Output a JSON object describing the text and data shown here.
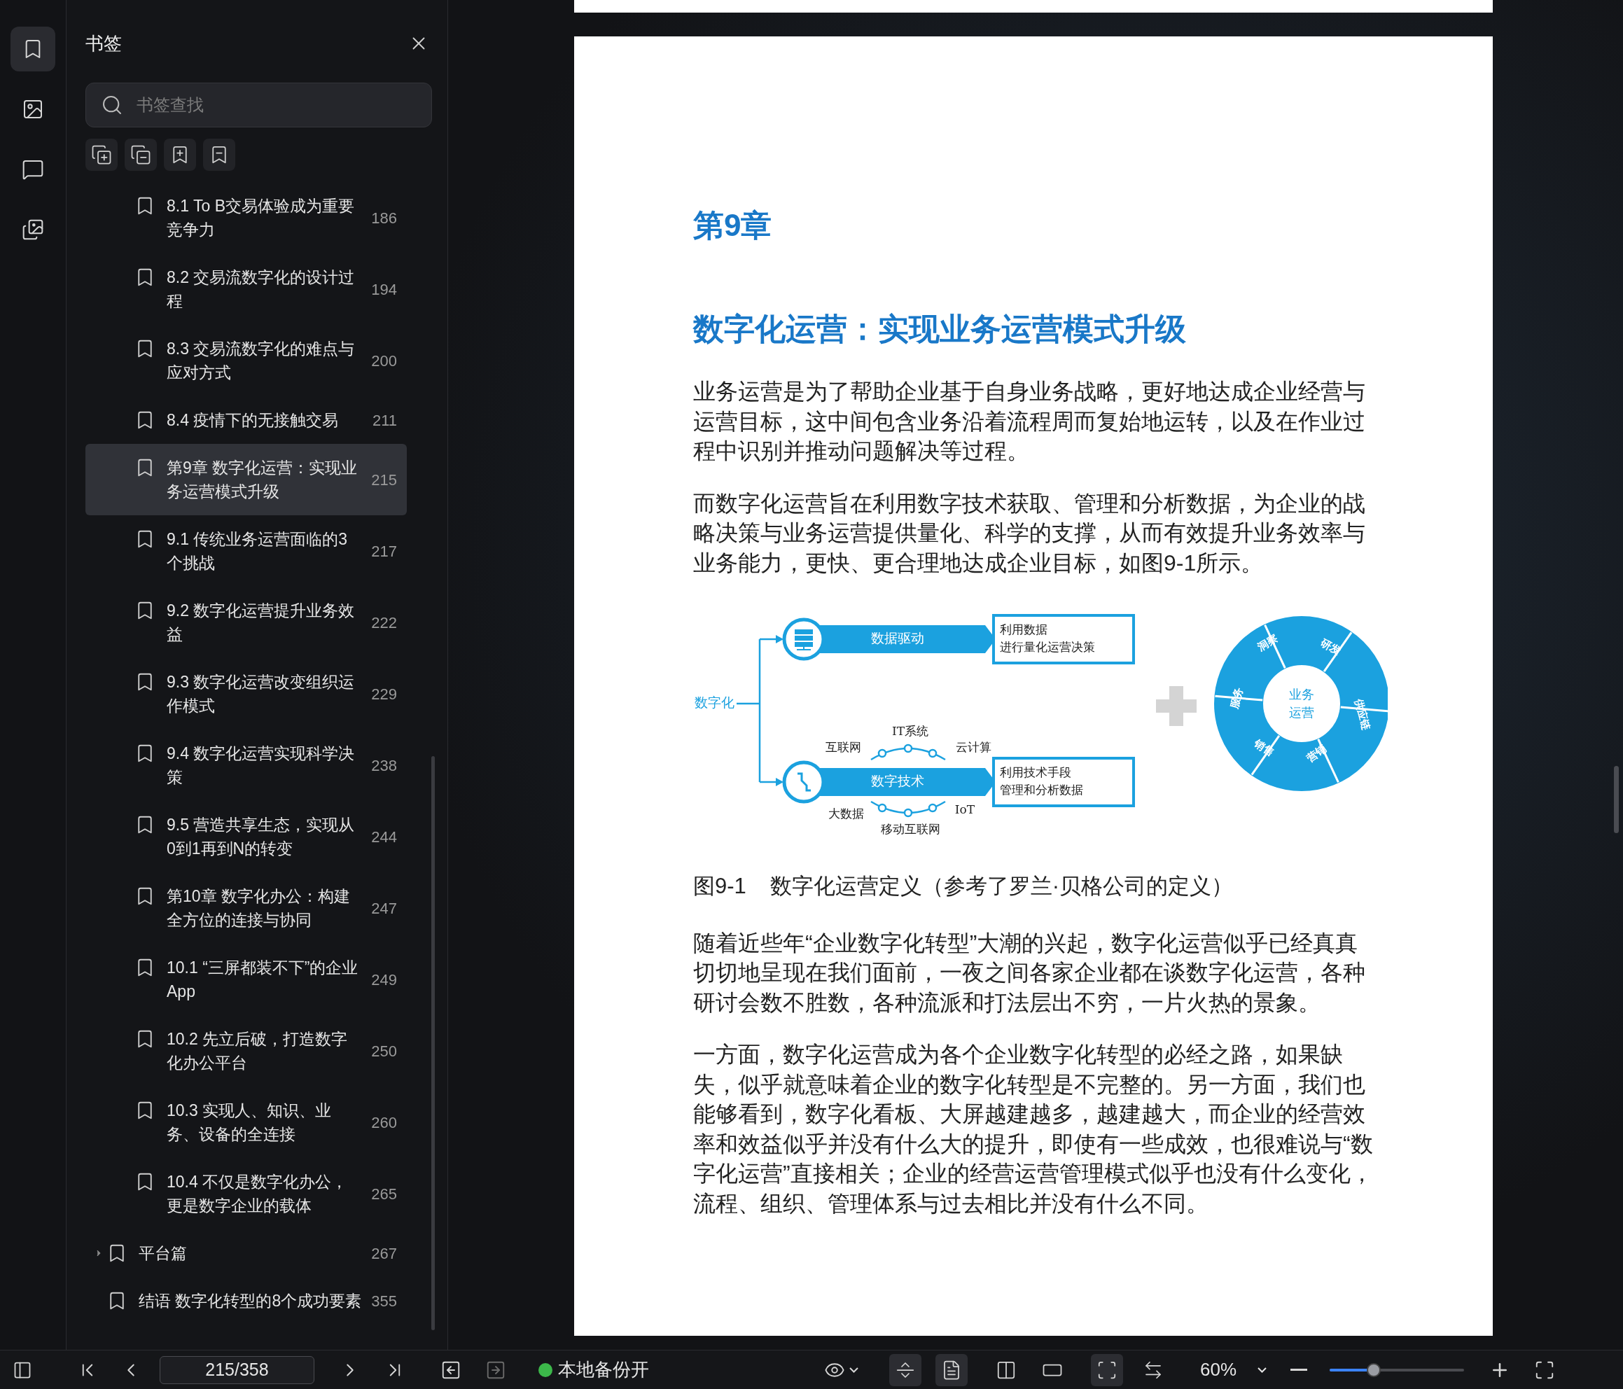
{
  "rail": [
    {
      "kind": "bookmark",
      "selected": true
    },
    {
      "kind": "image",
      "selected": false
    },
    {
      "kind": "comment",
      "selected": false
    },
    {
      "kind": "pages",
      "selected": false
    }
  ],
  "sidebar": {
    "title": "书签",
    "search": {
      "placeholder": "书签查找"
    },
    "items": [
      {
        "children": [
          {
            "title": "8.1 To B交易体验成为重要竞争力",
            "page": "186",
            "selected": false
          },
          {
            "title": "8.2 交易流数字化的设计过程",
            "page": "194",
            "selected": false
          },
          {
            "title": "8.3 交易流数字化的难点与应对方式",
            "page": "200",
            "selected": false
          },
          {
            "title": "8.4 疫情下的无接触交易",
            "page": "211",
            "selected": false
          },
          {
            "title": "第9章 数字化运营：实现业务运营模式升级",
            "page": "215",
            "selected": true
          },
          {
            "title": "9.1 传统业务运营面临的3个挑战",
            "page": "217",
            "selected": false
          },
          {
            "title": "9.2 数字化运营提升业务效益",
            "page": "222",
            "selected": false
          },
          {
            "title": "9.3 数字化运营改变组织运作模式",
            "page": "229",
            "selected": false
          },
          {
            "title": "9.4 数字化运营实现科学决策",
            "page": "238",
            "selected": false
          },
          {
            "title": "9.5 营造共享生态，实现从0到1再到N的转变",
            "page": "244",
            "selected": false
          },
          {
            "title": "第10章 数字化办公：构建全方位的连接与协同",
            "page": "247",
            "selected": false
          },
          {
            "title": "10.1 “三屏都装不下”的企业App",
            "page": "249",
            "selected": false
          },
          {
            "title": "10.2 先立后破，打造数字化办公平台",
            "page": "250",
            "selected": false
          },
          {
            "title": "10.3 实现人、知识、业务、设备的全连接",
            "page": "260",
            "selected": false
          },
          {
            "title": "10.4 不仅是数字化办公，更是数字企业的载体",
            "page": "265",
            "selected": false
          }
        ]
      },
      {
        "title": "平台篇",
        "page": "267",
        "selected": false,
        "expanded": false
      },
      {
        "title": "结语 数字化转型的8个成功要素",
        "page": "355",
        "selected": false
      }
    ]
  },
  "page": {
    "chapter": "第9章",
    "title": "数字化运营：实现业务运营模式升级",
    "paragraphs_before": [
      "业务运营是为了帮助企业基于自身业务战略，更好地达成企业经营与运营目标，这中间包含业务沿着流程周而复始地运转，以及在作业过程中识别并推动问题解决等过程。",
      "而数字化运营旨在利用数字技术获取、管理和分析数据，为企业的战略决策与业务运营提供量化、科学的支撑，从而有效提升业务效率与业务能力，更快、更合理地达成企业目标，如图9-1所示。"
    ],
    "figure": {
      "root": "数字化",
      "branches": [
        {
          "label": "数据驱动",
          "kind": "data",
          "note": [
            "利用数据",
            "进行量化运营决策"
          ]
        },
        {
          "label": "数字技术",
          "kind": "tech",
          "note": [
            "利用技术手段",
            "管理和分析数据"
          ]
        }
      ],
      "tech_above": [
        "互联网",
        "IT系统",
        "云计算"
      ],
      "tech_below": [
        "大数据",
        "移动互联网",
        "IoT"
      ],
      "ring_center": [
        "业务",
        "运营"
      ],
      "ring": [
        "洞察",
        "研发",
        "供应链",
        "营销",
        "销售",
        "服务"
      ]
    },
    "caption_number": "图9-1",
    "caption": "数字化运营定义（参考了罗兰·贝格公司的定义）",
    "paragraphs_after": [
      "随着近些年“企业数字化转型”大潮的兴起，数字化运营似乎已经真真切切地呈现在我们面前，一夜之间各家企业都在谈数字化运营，各种研讨会数不胜数，各种流派和打法层出不穷，一片火热的景象。",
      "一方面，数字化运营成为各个企业数字化转型的必经之路，如果缺失，似乎就意味着企业的数字化转型是不完整的。另一方面，我们也能够看到，数字化看板、大屏越建越多，越建越大，而企业的经营效率和效益似乎并没有什么大的提升，即使有一些成效，也很难说与“数字化运营”直接相关；企业的经营运营管理模式似乎也没有什么变化，流程、组织、管理体系与过去相比并没有什么不同。"
    ]
  },
  "toolbar": {
    "page_field": "215/358",
    "backup": {
      "label": "本地备份开",
      "on": true
    },
    "view_buttons": [
      {
        "kind": "split",
        "selected": true
      },
      {
        "kind": "single",
        "selected": true
      },
      {
        "kind": "double",
        "selected": false
      },
      {
        "kind": "actual",
        "selected": false
      },
      {
        "kind": "fit",
        "selected": true
      },
      {
        "kind": "width",
        "selected": false
      }
    ],
    "zoom": "60%",
    "zoom_slider": {
      "level": 0.33
    }
  }
}
